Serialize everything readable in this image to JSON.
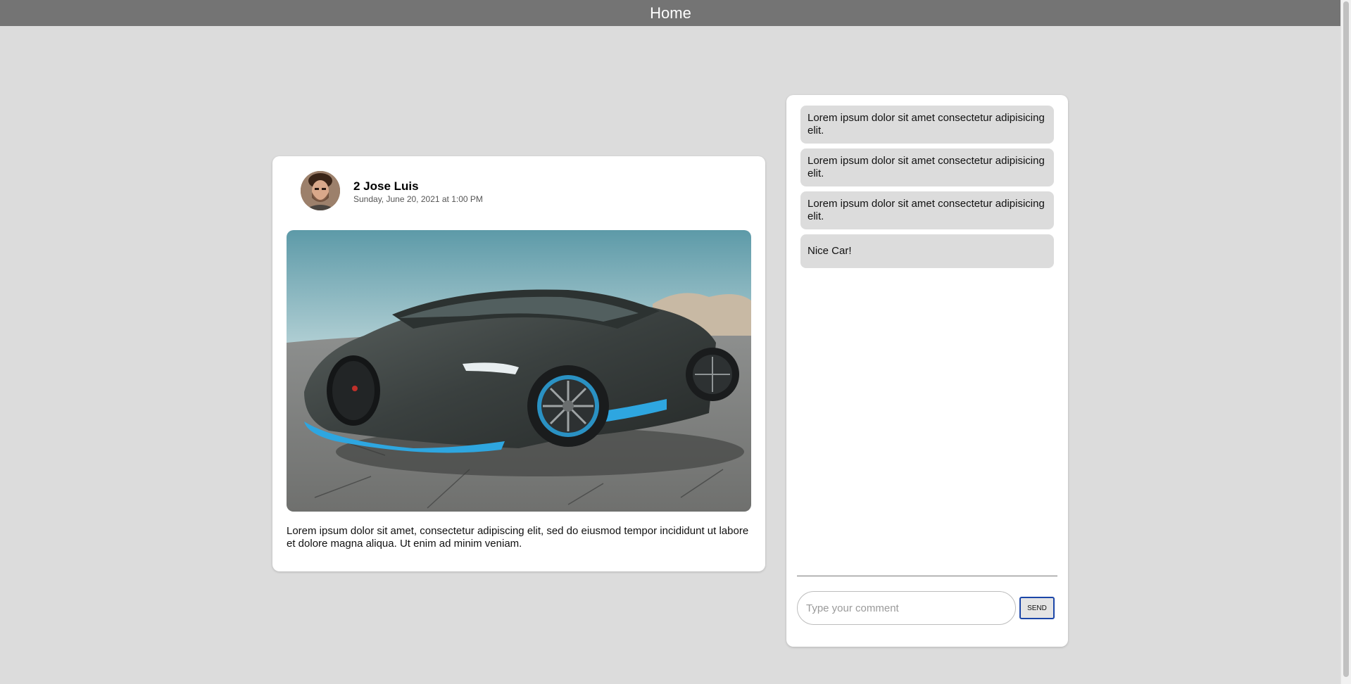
{
  "header": {
    "title": "Home"
  },
  "post": {
    "author": "2 Jose Luis",
    "date": "Sunday, June 20, 2021 at 1:00 PM",
    "text": "Lorem ipsum dolor sit amet, consectetur adipiscing elit, sed do eiusmod tempor incididunt ut labore et dolore magna aliqua. Ut enim ad minim veniam."
  },
  "comments": [
    {
      "text": "Lorem ipsum dolor sit amet consectetur adipisicing elit."
    },
    {
      "text": "Lorem ipsum dolor sit amet consectetur adipisicing elit."
    },
    {
      "text": "Lorem ipsum dolor sit amet consectetur adipisicing elit."
    },
    {
      "text": "Nice Car!"
    }
  ],
  "composer": {
    "placeholder": "Type your comment",
    "send_label": "SEND"
  },
  "colors": {
    "header_bg": "#747474",
    "page_bg": "#dcdcdc",
    "send_border": "#1b46a8"
  }
}
